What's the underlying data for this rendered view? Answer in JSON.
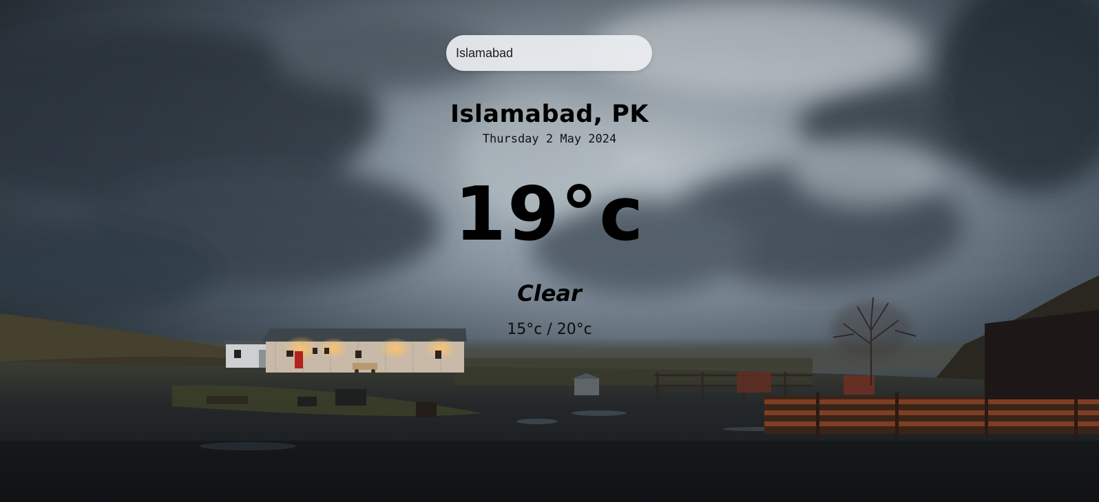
{
  "search": {
    "value": "Islamabad",
    "placeholder": ""
  },
  "weather": {
    "location": "Islamabad, PK",
    "date": "Thursday 2 May 2024",
    "temperature": "19°c",
    "condition": "Clear",
    "hi_low": "15°c / 20°c"
  },
  "background": {
    "description_icon": "stormy-sky-farmhouse-photo",
    "sky_color": "#8d9aa5",
    "ground_color": "#1c1f22",
    "house_light_color": "#f0a64a"
  }
}
